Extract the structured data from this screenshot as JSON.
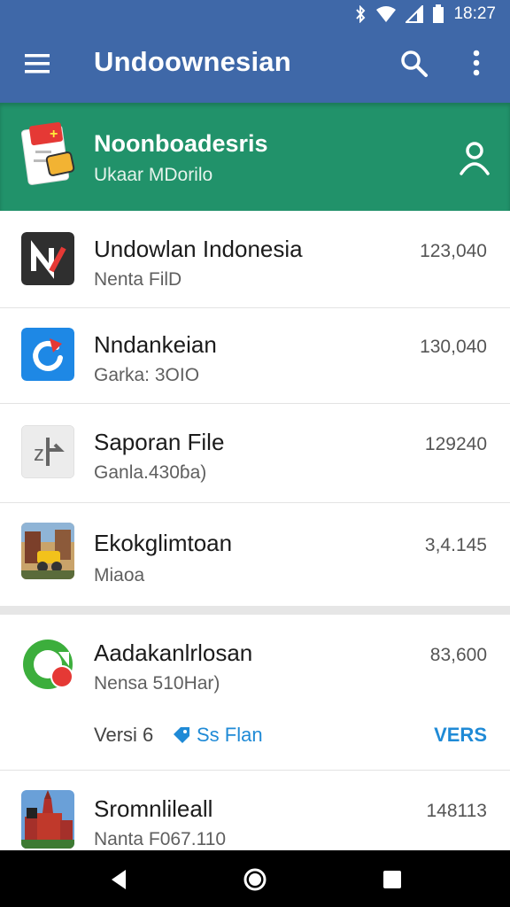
{
  "status_bar": {
    "time": "18:27",
    "icons": [
      "bluetooth-icon",
      "wifi-icon",
      "signal-icon",
      "battery-icon"
    ]
  },
  "app_bar": {
    "title": "Undoownesian",
    "icons": [
      "menu-icon",
      "search-icon",
      "more-vert-icon"
    ]
  },
  "banner": {
    "title": "Noonboadesris",
    "subtitle": "Ukaar MDorilo",
    "icons": [
      "app-logo-icon",
      "user-icon"
    ]
  },
  "list": [
    {
      "title": "Undowlan Indonesia",
      "subtitle": "Nenta FilD",
      "value": "123,040",
      "icon": "n-app-icon"
    },
    {
      "title": "Nndankeian",
      "subtitle": "Garka: 3OIO",
      "value": "130,040",
      "icon": "refresh-app-icon"
    },
    {
      "title": "Saporan File",
      "subtitle": "Ganla.430ɓa)",
      "value": "129240",
      "icon": "arrow-app-icon"
    },
    {
      "title": "Ekokglimtoan",
      "subtitle": "Miaoa",
      "value": "3,4.145",
      "icon": "game-app-icon"
    },
    {
      "title": "Aadakanlrlosan",
      "subtitle": "Nensa 510Har)",
      "value": "83,600",
      "icon": "circle-app-icon"
    },
    {
      "title": "Sromnlileall",
      "subtitle": "Nanta F067.110",
      "value": "148113",
      "icon": "palace-app-icon"
    }
  ],
  "version_row": {
    "label": "Versi 6",
    "link": "Ss Flan",
    "right": "VERS"
  },
  "colors": {
    "app_bar": "#3f68a8",
    "banner": "#21926a",
    "link": "#1f8ad6"
  },
  "nav_bar": {
    "icons": [
      "back-icon",
      "home-icon",
      "recents-icon"
    ]
  }
}
